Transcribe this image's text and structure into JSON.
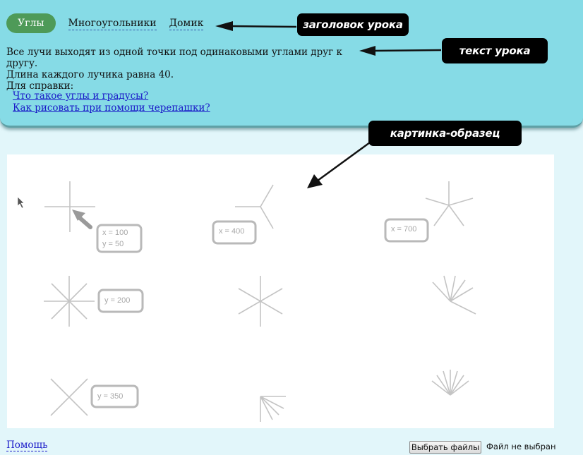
{
  "tabs": [
    {
      "label": "Углы",
      "active": true
    },
    {
      "label": "Многоугольники",
      "active": false
    },
    {
      "label": "Домик",
      "active": false
    }
  ],
  "lesson": {
    "line1": "Все лучи выходят из одной точки под одинаковыми углами друг к другу.",
    "line2": "Длина каждого лучика равна 40."
  },
  "reference": {
    "title": "Для справки:",
    "link1": "Что такое углы и градусы?",
    "link2": "Как рисовать при помощи черепашки?"
  },
  "annotations": {
    "lesson_title": "заголовок урока",
    "lesson_text": "текст урока",
    "sample_picture": "картинка-образец"
  },
  "sample_labels": {
    "first_x": "x = 100",
    "first_y": "y = 50",
    "second_x": "x = 400",
    "third_x": "x = 700",
    "row2_y": "y = 200",
    "row3_y": "y = 350"
  },
  "footer": {
    "help": "Помощь",
    "file_button": "Выбрать файлы",
    "file_status": "Файл не выбран"
  },
  "colors": {
    "active_tab": "#4e9a58",
    "panel": "#86dbe6",
    "background": "#e2f6fa",
    "link": "#1a1ac8"
  }
}
